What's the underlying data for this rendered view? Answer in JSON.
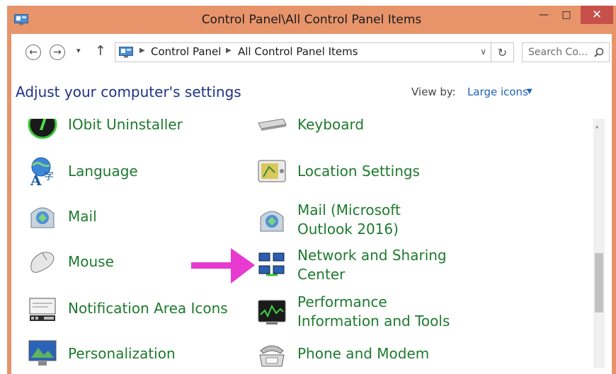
{
  "window": {
    "title": "Control Panel\\All Control Panel Items",
    "minimize_glyph": "—",
    "maximize_glyph": "□",
    "close_glyph": "✕"
  },
  "nav": {
    "back_glyph": "←",
    "forward_glyph": "→",
    "recent_glyph": "▾",
    "up_glyph": "↑",
    "breadcrumbs": [
      "Control Panel",
      "All Control Panel Items"
    ],
    "address_chevron": "∨",
    "refresh_glyph": "↻",
    "search_placeholder": "Search Co..."
  },
  "header": {
    "title": "Adjust your computer's settings",
    "view_by_label": "View by:",
    "view_by_value": "Large icons",
    "view_by_caret": "▼"
  },
  "items": [
    {
      "label": "IObit Uninstaller",
      "icon": "iobit-icon"
    },
    {
      "label": "Keyboard",
      "icon": "keyboard-icon"
    },
    {
      "label": "Language",
      "icon": "language-icon"
    },
    {
      "label": "Location Settings",
      "icon": "location-icon"
    },
    {
      "label": "Mail",
      "icon": "mail-icon"
    },
    {
      "label": "Mail (Microsoft Outlook 2016)",
      "icon": "mail-icon"
    },
    {
      "label": "Mouse",
      "icon": "mouse-icon"
    },
    {
      "label": "Network and Sharing Center",
      "icon": "network-icon"
    },
    {
      "label": "Notification Area Icons",
      "icon": "notification-icon"
    },
    {
      "label": "Performance Information and Tools",
      "icon": "performance-icon"
    },
    {
      "label": "Personalization",
      "icon": "personalization-icon"
    },
    {
      "label": "Phone and Modem",
      "icon": "phone-icon"
    }
  ],
  "scrollbar": {
    "up_glyph": "˄"
  },
  "colors": {
    "titlebar": "#e8946b",
    "close_button": "#c7504a",
    "heading": "#1e3287",
    "link_green": "#1e7a2e",
    "link_blue": "#1f60b8",
    "annotation_arrow": "#e83ad0"
  }
}
